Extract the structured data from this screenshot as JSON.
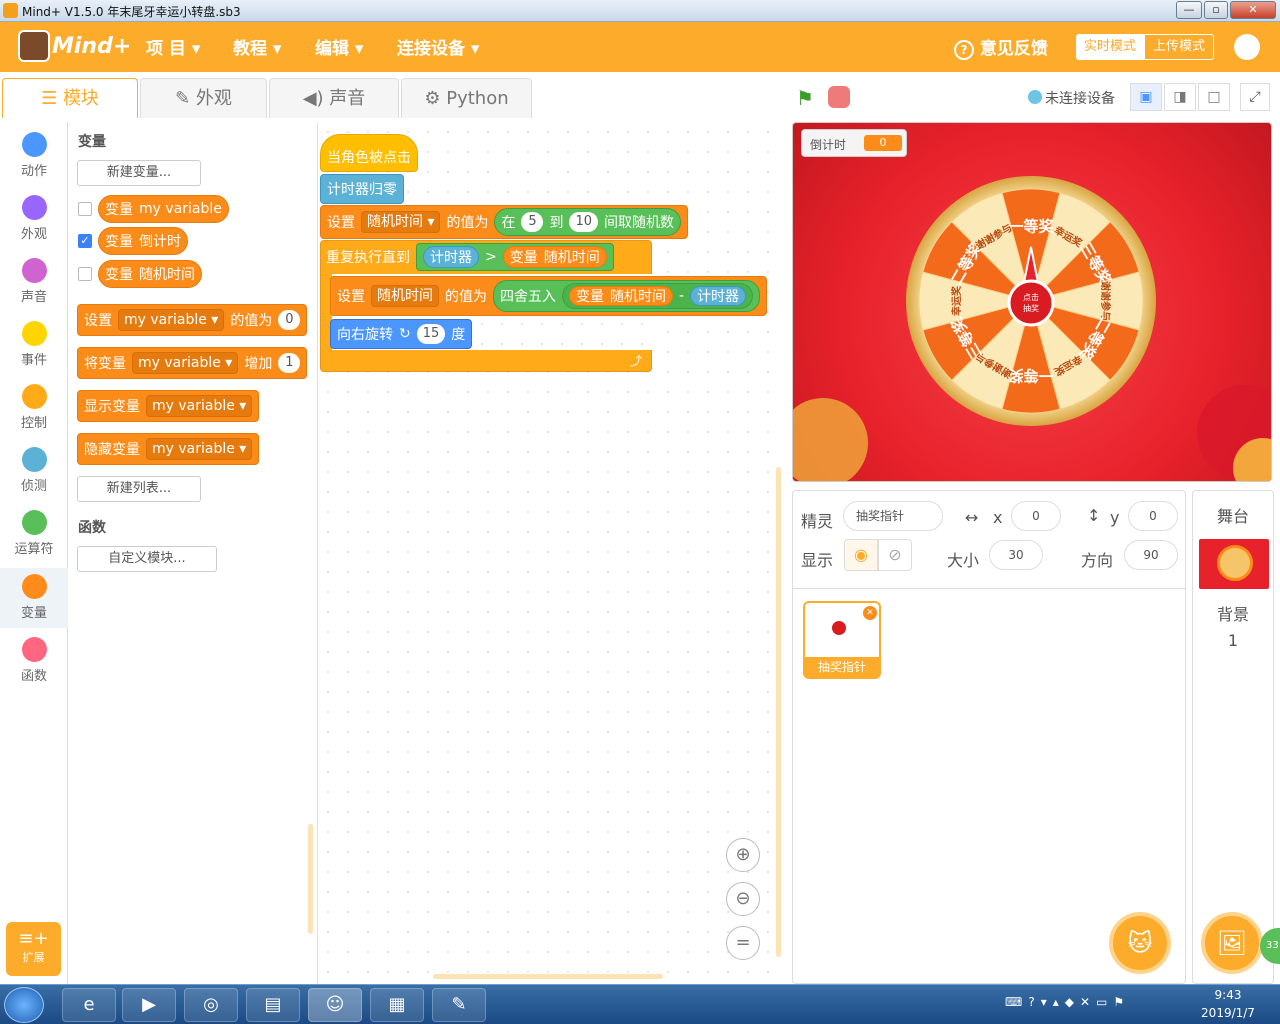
{
  "window": {
    "title": "Mind+ V1.5.0     年末尾牙幸运小转盘.sb3",
    "min": "—",
    "max": "▫",
    "close": "✕"
  },
  "menubar": {
    "logo": "Mind+",
    "items": [
      "项 目",
      "教程",
      "编辑",
      "连接设备"
    ],
    "feedback": "意见反馈",
    "mode_live": "实时模式",
    "mode_upload": "上传模式"
  },
  "tabs": [
    "模块",
    "外观",
    "声音",
    "Python"
  ],
  "stage_controls": {
    "device_status": "未连接设备"
  },
  "categories": [
    {
      "label": "动作",
      "color": "#4c97ff"
    },
    {
      "label": "外观",
      "color": "#9966ff"
    },
    {
      "label": "声音",
      "color": "#cf63cf"
    },
    {
      "label": "事件",
      "color": "#ffd500"
    },
    {
      "label": "控制",
      "color": "#ffab19"
    },
    {
      "label": "侦测",
      "color": "#5cb1d6"
    },
    {
      "label": "运算符",
      "color": "#59c059"
    },
    {
      "label": "变量",
      "color": "#ff8c1a"
    },
    {
      "label": "函数",
      "color": "#ff6680"
    }
  ],
  "extend_label": "扩展",
  "palette": {
    "var_title": "变量",
    "new_var": "新建变量...",
    "vars": [
      {
        "label": "变量",
        "name": "my variable",
        "checked": false
      },
      {
        "label": "变量",
        "name": "倒计时",
        "checked": true
      },
      {
        "label": "变量",
        "name": "随机时间",
        "checked": false
      }
    ],
    "set_block": {
      "prefix": "设置",
      "var": "my variable ▾",
      "mid": "的值为",
      "val": "0"
    },
    "change_block": {
      "prefix": "将变量",
      "var": "my variable ▾",
      "mid": "增加",
      "val": "1"
    },
    "show_block": {
      "prefix": "显示变量",
      "var": "my variable ▾"
    },
    "hide_block": {
      "prefix": "隐藏变量",
      "var": "my variable ▾"
    },
    "new_list": "新建列表...",
    "func_title": "函数",
    "new_func": "自定义模块..."
  },
  "script": {
    "hat": "当角色被点击",
    "reset": "计时器归零",
    "set1": {
      "prefix": "设置",
      "var": "随机时间 ▾",
      "mid": "的值为",
      "rand_pre": "在",
      "a": "5",
      "to": "到",
      "b": "10",
      "rand_post": "间取随机数"
    },
    "repeat": {
      "label": "重复执行直到",
      "timer": "计时器",
      "op": ">",
      "var_label": "变量",
      "var": "随机时间"
    },
    "set2": {
      "prefix": "设置",
      "var": "随机时间",
      "mid": "的值为",
      "round": "四舍五入",
      "var_label": "变量",
      "op": "-",
      "timer": "计时器"
    },
    "turn": {
      "label": "向右旋转",
      "icon": "↻",
      "val": "15",
      "unit": "度"
    },
    "loop_end": "⤴"
  },
  "zoom": [
    "⊕",
    "⊖",
    "="
  ],
  "stage": {
    "monitor_label": "倒计时",
    "monitor_value": "0",
    "center": "点击\n抽奖",
    "segments": [
      "一等奖",
      "幸运奖",
      "三等奖",
      "谢谢参与",
      "二等奖",
      "幸运奖",
      "一等奖",
      "谢谢参与",
      "三等奖",
      "幸运奖",
      "二等奖",
      "谢谢参与"
    ]
  },
  "sprite_info": {
    "sprite_label": "精灵",
    "sprite_name": "抽奖指针",
    "x_label": "x",
    "x": "0",
    "y_label": "y",
    "y": "0",
    "show_label": "显示",
    "size_label": "大小",
    "size": "30",
    "dir_label": "方向",
    "dir": "90",
    "thumb_name": "抽奖指针"
  },
  "stage_pane": {
    "title": "舞台",
    "bg_label": "背景",
    "bg_count": "1"
  },
  "taskbar": {
    "time": "9:43",
    "date": "2019/1/7",
    "badge": "33"
  }
}
